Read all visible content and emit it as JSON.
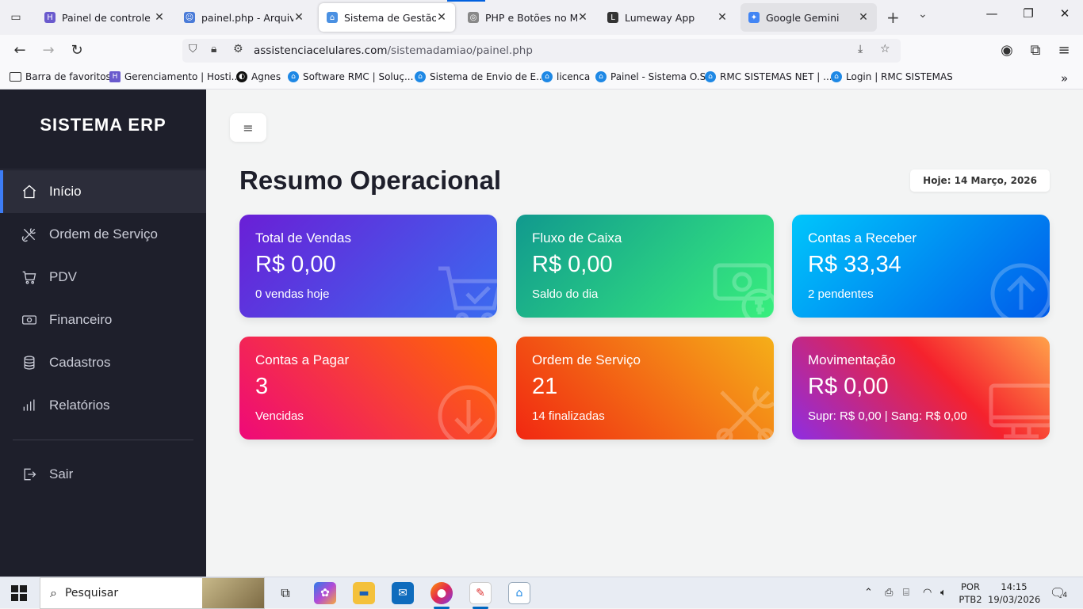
{
  "browser": {
    "tabs": [
      {
        "title": "Painel de controle | Ho",
        "fav_color": "#6a5acd",
        "fav_glyph": "H"
      },
      {
        "title": "painel.php - Arquivos -",
        "fav_color": "#4a7bd8",
        "fav_glyph": "☺"
      },
      {
        "title": "Sistema de Gestão Pro",
        "fav_color": "#4a90e2",
        "fav_glyph": "⌂"
      },
      {
        "title": "PHP e Botões no Menu",
        "fav_color": "#777777",
        "fav_glyph": "◎"
      },
      {
        "title": "Lumeway App",
        "fav_color": "#333333",
        "fav_glyph": "L"
      },
      {
        "title": "Google Gemini",
        "fav_color": "#4285f4",
        "fav_glyph": "✦"
      }
    ],
    "url_host": "assistenciacelulares.com",
    "url_path": "/sistemadamiao/painel.php",
    "bookmarks": [
      {
        "label": "Barra de favoritos",
        "icon": "folder-icon"
      },
      {
        "label": "Gerenciamento | Hosti...",
        "icon": "hostinger-icon"
      },
      {
        "label": "Agnes",
        "icon": "agnes-icon"
      },
      {
        "label": "Software RMC | Soluç...",
        "icon": "home-icon"
      },
      {
        "label": "Sistema de Envio de E...",
        "icon": "home-icon"
      },
      {
        "label": "licenca",
        "icon": "home-icon"
      },
      {
        "label": "Painel - Sistema O.S",
        "icon": "home-icon"
      },
      {
        "label": "RMC SISTEMAS NET | ...",
        "icon": "home-icon"
      },
      {
        "label": "Login | RMC SISTEMAS",
        "icon": "home-icon"
      }
    ]
  },
  "sidebar": {
    "brand": "SISTEMA ERP",
    "items": [
      {
        "label": "Início",
        "icon": "home-icon"
      },
      {
        "label": "Ordem de Serviço",
        "icon": "tools-icon"
      },
      {
        "label": "PDV",
        "icon": "cart-icon"
      },
      {
        "label": "Financeiro",
        "icon": "cash-icon"
      },
      {
        "label": "Cadastros",
        "icon": "database-icon"
      },
      {
        "label": "Relatórios",
        "icon": "bar-chart-icon"
      }
    ],
    "logout": {
      "label": "Sair",
      "icon": "logout-icon"
    }
  },
  "main": {
    "title": "Resumo Operacional",
    "date": "Hoje: 14 Março, 2026",
    "cards": [
      {
        "title": "Total de Vendas",
        "value": "R$ 0,00",
        "sub": "0 vendas hoje",
        "icon": "cart-icon",
        "gradient": [
          "#6a1fd6",
          "#3a6bf0"
        ]
      },
      {
        "title": "Fluxo de Caixa",
        "value": "R$ 0,00",
        "sub": "Saldo do dia",
        "icon": "cash-icon",
        "gradient": [
          "#11998e",
          "#38ef7d"
        ]
      },
      {
        "title": "Contas a Receber",
        "value": "R$ 33,34",
        "sub": "2 pendentes",
        "icon": "arrow-up-circle-icon",
        "gradient": [
          "#00c6fb",
          "#005bea"
        ]
      },
      {
        "title": "Contas a Pagar",
        "value": "3",
        "sub": "Vencidas",
        "icon": "arrow-down-circle-icon",
        "gradient": [
          "#ee0979",
          "#ff6a00"
        ]
      },
      {
        "title": "Ordem de Serviço",
        "value": "21",
        "sub": "14 finalizadas",
        "icon": "tools-icon",
        "gradient": [
          "#f12711",
          "#f5af19"
        ]
      },
      {
        "title": "Movimentação",
        "value": "R$ 0,00",
        "sub": "Supr: R$ 0,00 | Sang: R$ 0,00",
        "icon": "monitor-icon",
        "gradient": [
          "#8e2de2",
          "#f5222d",
          "#ffa24a"
        ]
      }
    ]
  },
  "taskbar": {
    "search_label": "Pesquisar",
    "lang_top": "POR",
    "lang_bottom": "PTB2",
    "time": "14:15",
    "date": "19/03/2026",
    "notifications": "4"
  }
}
